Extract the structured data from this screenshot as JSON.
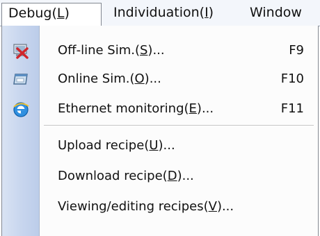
{
  "menubar": {
    "items": [
      {
        "label_pre": "Debug(",
        "mnemonic": "L",
        "label_post": ")"
      },
      {
        "label_pre": "Individuation(",
        "mnemonic": "I",
        "label_post": ")"
      },
      {
        "label": "Window"
      }
    ]
  },
  "menu": {
    "items": [
      {
        "pre": "Off-line Sim.(",
        "mn": "S",
        "post": ")...",
        "shortcut": "F9",
        "icon": "offline-sim-icon"
      },
      {
        "pre": "Online Sim.(",
        "mn": "O",
        "post": ")...",
        "shortcut": "F10",
        "icon": "online-sim-icon"
      },
      {
        "pre": "Ethernet monitoring(",
        "mn": "E",
        "post": ")...",
        "shortcut": "F11",
        "icon": "ethernet-monitoring-icon"
      },
      {
        "pre": "Upload recipe(",
        "mn": "U",
        "post": ")..."
      },
      {
        "pre": "Download recipe(",
        "mn": "D",
        "post": ")..."
      },
      {
        "pre": "Viewing/editing recipes(",
        "mn": "V",
        "post": ")..."
      }
    ]
  },
  "colors": {
    "gutter": "#c7d5ee",
    "menubar_bg": "#f3f6fb",
    "border": "#828790"
  }
}
